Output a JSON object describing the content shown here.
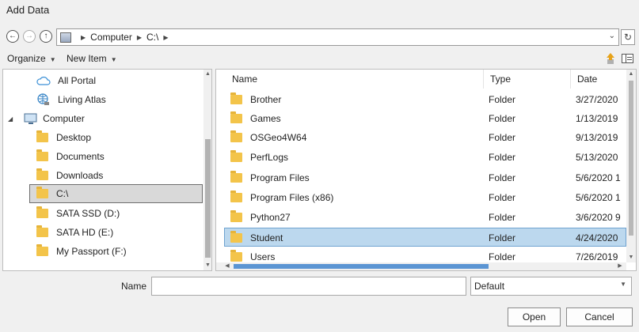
{
  "window": {
    "title": "Add Data"
  },
  "address": {
    "segments": [
      "Computer",
      "C:\\"
    ]
  },
  "toolbar": {
    "organize": "Organize",
    "new_item": "New Item"
  },
  "tree": {
    "items": [
      {
        "label": "All Portal",
        "icon": "cloud-icon"
      },
      {
        "label": "Living Atlas",
        "icon": "globe-icon"
      },
      {
        "label": "Computer",
        "icon": "computer-icon"
      },
      {
        "label": "Desktop",
        "icon": "folder-icon"
      },
      {
        "label": "Documents",
        "icon": "folder-icon"
      },
      {
        "label": "Downloads",
        "icon": "folder-icon"
      },
      {
        "label": "C:\\",
        "icon": "folder-icon",
        "selected": true
      },
      {
        "label": "SATA SSD (D:)",
        "icon": "folder-icon"
      },
      {
        "label": "SATA HD (E:)",
        "icon": "folder-icon"
      },
      {
        "label": "My Passport (F:)",
        "icon": "folder-icon"
      }
    ]
  },
  "list": {
    "columns": [
      "Name",
      "Type",
      "Date"
    ],
    "rows": [
      {
        "name": "Brother",
        "type": "Folder",
        "date": "3/27/2020"
      },
      {
        "name": "Games",
        "type": "Folder",
        "date": "1/13/2019"
      },
      {
        "name": "OSGeo4W64",
        "type": "Folder",
        "date": "9/13/2019"
      },
      {
        "name": "PerfLogs",
        "type": "Folder",
        "date": "5/13/2020"
      },
      {
        "name": "Program Files",
        "type": "Folder",
        "date": "5/6/2020 1"
      },
      {
        "name": "Program Files (x86)",
        "type": "Folder",
        "date": "5/6/2020 1"
      },
      {
        "name": "Python27",
        "type": "Folder",
        "date": "3/6/2020 9"
      },
      {
        "name": "Student",
        "type": "Folder",
        "date": "4/24/2020",
        "selected": true
      },
      {
        "name": "Users",
        "type": "Folder",
        "date": "7/26/2019"
      }
    ]
  },
  "footer": {
    "name_label": "Name",
    "name_value": "",
    "filter_value": "Default",
    "open_label": "Open",
    "cancel_label": "Cancel"
  },
  "colors": {
    "selection": "#bcd8ee",
    "scroll_accent": "#5b95d3",
    "folder": "#f3c44a"
  }
}
